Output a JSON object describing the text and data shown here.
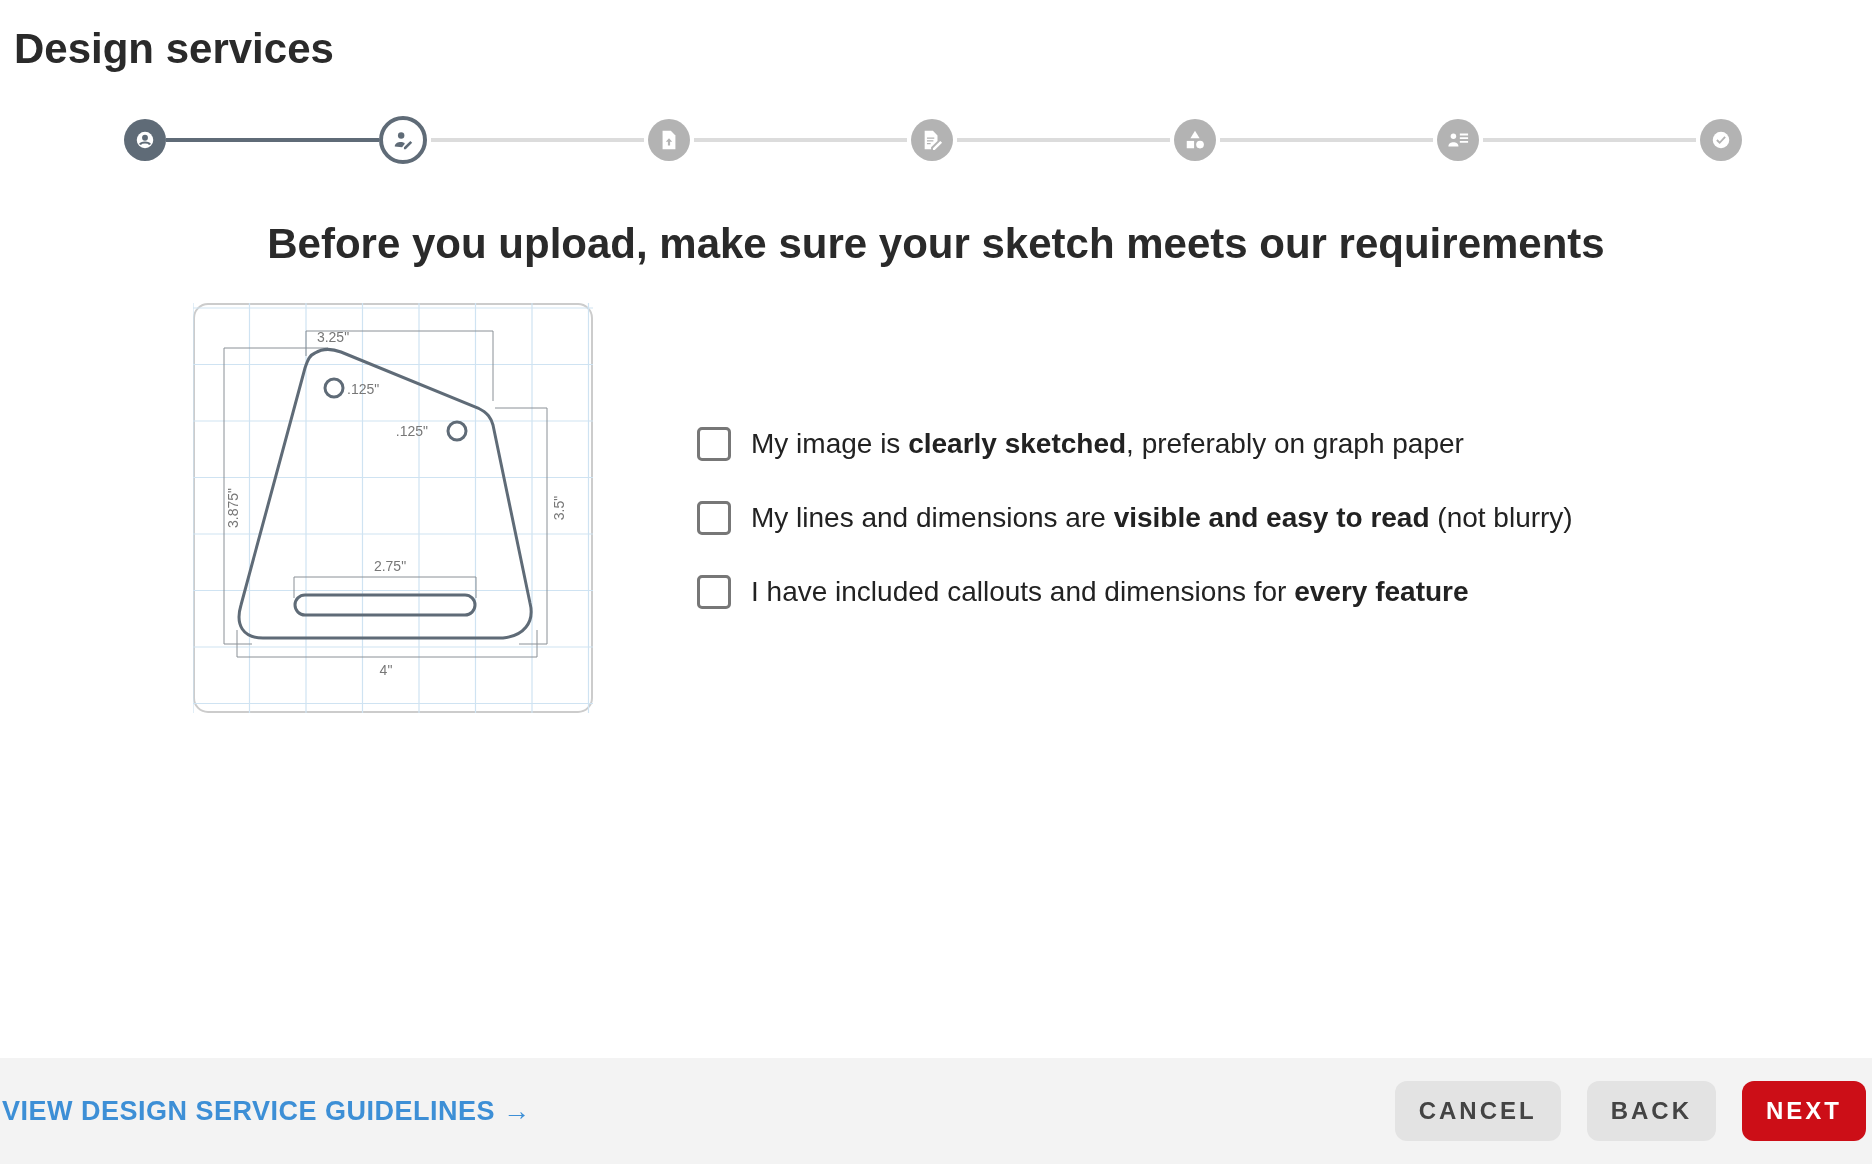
{
  "title": "Design services",
  "steps": [
    {
      "done": true,
      "selected": false
    },
    {
      "done": false,
      "selected": true
    },
    {
      "done": false,
      "selected": false
    },
    {
      "done": false,
      "selected": false
    },
    {
      "done": false,
      "selected": false
    },
    {
      "done": false,
      "selected": false
    },
    {
      "done": false,
      "selected": false
    }
  ],
  "heading": "Before you upload, make sure your sketch meets our requirements",
  "sketch": {
    "labels": [
      {
        "kind": "top",
        "text": "3.25\""
      },
      {
        "kind": "hole1",
        "text": ".125\""
      },
      {
        "kind": "hole2",
        "text": ".125\""
      },
      {
        "kind": "left",
        "text": "3.875\""
      },
      {
        "kind": "right",
        "text": "3.5\""
      },
      {
        "kind": "slot",
        "text": "2.75\""
      },
      {
        "kind": "bottom",
        "text": "4\""
      }
    ]
  },
  "requirements": [
    {
      "text": "My image is **clearly sketched**, preferably on graph paper",
      "checked": false
    },
    {
      "text": "My lines and dimensions are **visible and easy to read** (not blurry)",
      "checked": false
    },
    {
      "text": "I have included callouts and dimensions for **every feature**",
      "checked": false
    }
  ],
  "footer": {
    "link": "VIEW DESIGN SERVICE GUIDELINES →",
    "buttons": [
      {
        "kind": "cancel",
        "label": "CANCEL"
      },
      {
        "kind": "back",
        "label": "BACK"
      },
      {
        "kind": "next",
        "label": "NEXT"
      }
    ]
  }
}
